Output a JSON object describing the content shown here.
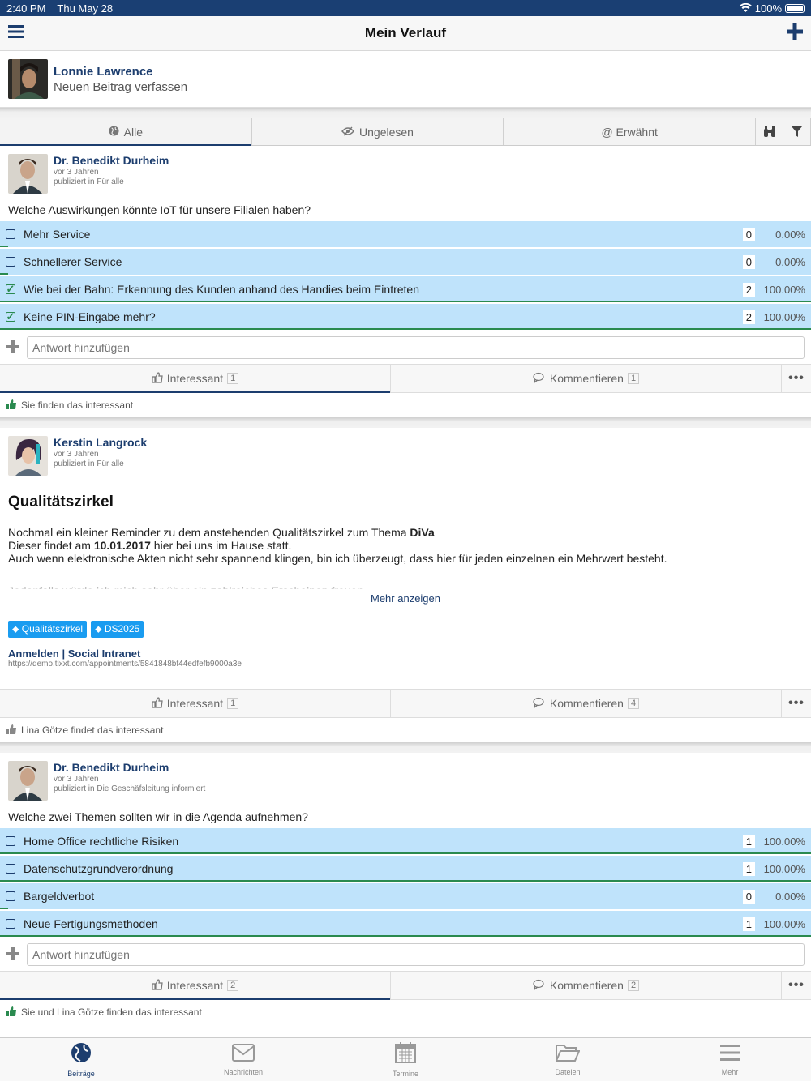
{
  "status": {
    "time": "2:40 PM",
    "date": "Thu May 28",
    "battery": "100%"
  },
  "nav": {
    "title": "Mein Verlauf"
  },
  "compose": {
    "name": "Lonnie Lawrence",
    "prompt": "Neuen Beitrag verfassen"
  },
  "filters": {
    "all": "Alle",
    "unread": "Ungelesen",
    "mentioned": "@ Erwähnt"
  },
  "post1": {
    "author": "Dr. Benedikt Durheim",
    "time": "vor 3 Jahren",
    "published": "publiziert in Für alle",
    "question": "Welche Auswirkungen könnte IoT für unsere Filialen haben?",
    "options": [
      {
        "label": "Mehr Service",
        "count": "0",
        "pct": "0.00%",
        "checked": false,
        "fill": 0
      },
      {
        "label": "Schnellerer Service",
        "count": "0",
        "pct": "0.00%",
        "checked": false,
        "fill": 0
      },
      {
        "label": "Wie bei der Bahn: Erkennung des Kunden anhand des Handies beim Eintreten",
        "count": "2",
        "pct": "100.00%",
        "checked": true,
        "fill": 1
      },
      {
        "label": "Keine PIN-Eingabe mehr?",
        "count": "2",
        "pct": "100.00%",
        "checked": true,
        "fill": 1
      }
    ],
    "add_placeholder": "Antwort hinzufügen",
    "interesting": "Interessant",
    "interesting_count": "1",
    "comment": "Kommentieren",
    "comment_count": "1",
    "like_text": "Sie finden das interessant"
  },
  "post2": {
    "author": "Kerstin Langrock",
    "time": "vor 3 Jahren",
    "published": "publiziert in Für alle",
    "title": "Qualitätszirkel",
    "line1_pre": "Nochmal ein kleiner Reminder zu dem anstehenden Qualitätszirkel zum Thema ",
    "line1_bold": "DiVa",
    ".": ".",
    "line2_pre": "Dieser findet am ",
    "line2_bold": "10.01.2017",
    "line2_post": " hier bei uns im Hause statt.",
    "line3": "Auch wenn elektronische Akten nicht sehr spannend klingen, bin ich überzeugt, dass hier für jeden einzelnen ein Mehrwert besteht.",
    "faded": "Jedenfalls würde ich mich sehr über ein zahlreiches Erscheinen freuen.",
    "more": "Mehr anzeigen",
    "tags": [
      "Qualitätszirkel",
      "DS2025"
    ],
    "link_title": "Anmelden | Social Intranet",
    "link_url": "https://demo.tixxt.com/appointments/5841848bf44edfefb9000a3e",
    "interesting": "Interessant",
    "interesting_count": "1",
    "comment": "Kommentieren",
    "comment_count": "4",
    "like_text": "Lina Götze findet das interessant"
  },
  "post3": {
    "author": "Dr. Benedikt Durheim",
    "time": "vor 3 Jahren",
    "published": "publiziert in Die Geschäfsleitung informiert",
    "question": "Welche zwei Themen sollten wir in die Agenda aufnehmen?",
    "options": [
      {
        "label": "Home Office rechtliche Risiken",
        "count": "1",
        "pct": "100.00%",
        "checked": false,
        "fill": 1
      },
      {
        "label": "Datenschutzgrundverordnung",
        "count": "1",
        "pct": "100.00%",
        "checked": false,
        "fill": 1
      },
      {
        "label": "Bargeldverbot",
        "count": "0",
        "pct": "0.00%",
        "checked": false,
        "fill": 0
      },
      {
        "label": "Neue Fertigungsmethoden",
        "count": "1",
        "pct": "100.00%",
        "checked": false,
        "fill": 1
      }
    ],
    "add_placeholder": "Antwort hinzufügen",
    "interesting": "Interessant",
    "interesting_count": "2",
    "comment": "Kommentieren",
    "comment_count": "2",
    "like_text": "Sie und Lina Götze finden das interessant"
  },
  "tabs": [
    "Beiträge",
    "Nachrichten",
    "Termine",
    "Dateien",
    "Mehr"
  ],
  "colors": {
    "primary": "#1c3d6e",
    "poll_bg": "#bfe3fb",
    "vote_bar": "#2a8a4f",
    "tag": "#1a9cf0"
  }
}
